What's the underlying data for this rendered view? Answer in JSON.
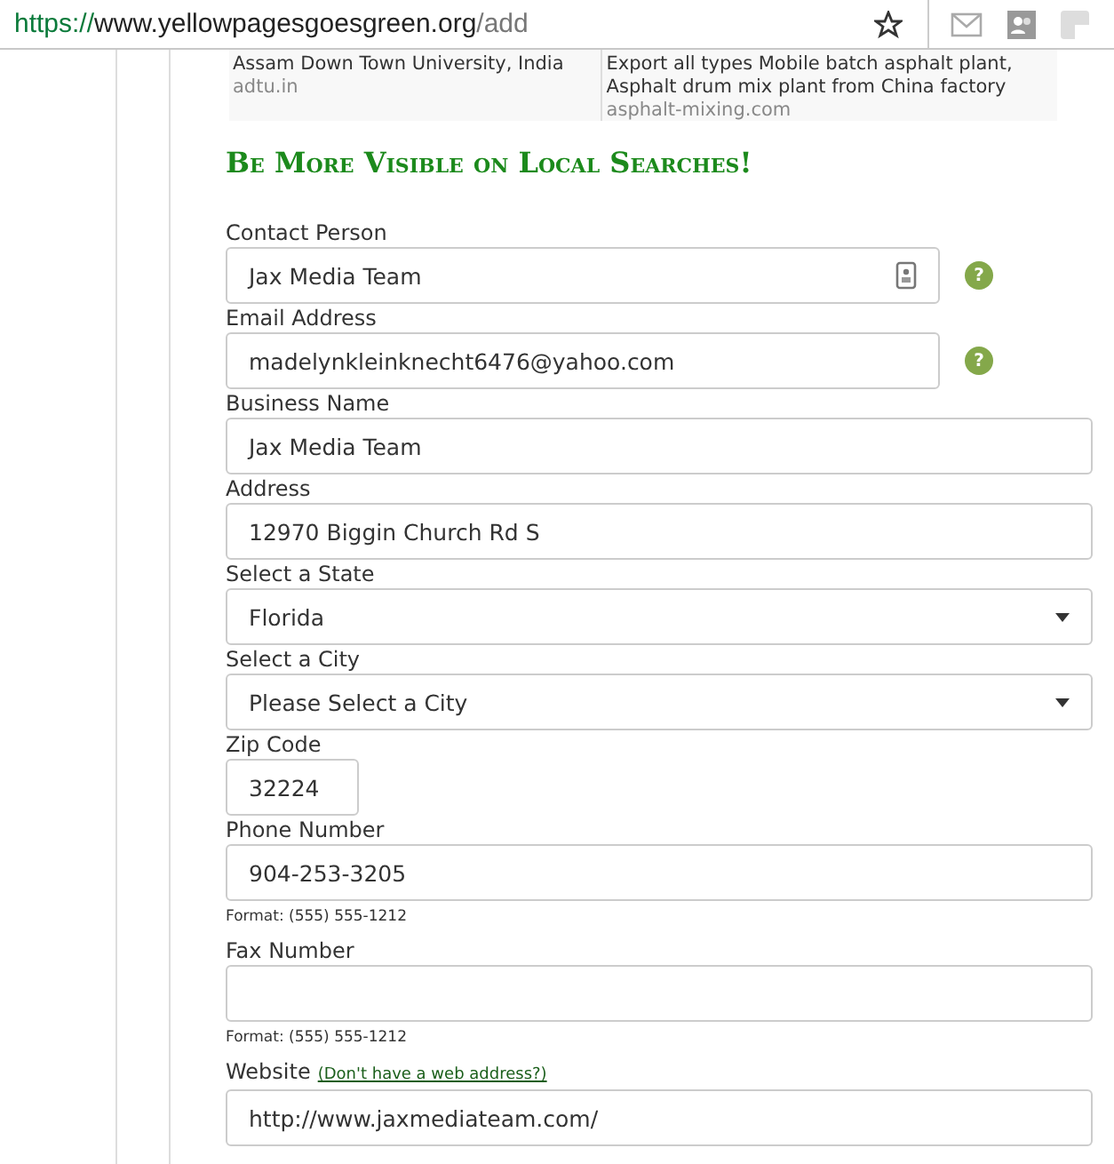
{
  "browser": {
    "url_scheme": "https://",
    "url_host": "www.yellowpagesgoesgreen.org",
    "url_path": "/add"
  },
  "ads": [
    {
      "description": "Assam Down Town University, India",
      "domain": "adtu.in"
    },
    {
      "description": "Export all types Mobile batch asphalt plant, Asphalt drum mix plant from China factory",
      "domain": "asphalt-mixing.com"
    }
  ],
  "heading": "Be More Visible on Local Searches!",
  "fields": [
    {
      "kind": "text",
      "label": "Contact Person",
      "value": "Jax Media Team",
      "help": "?",
      "autofill": true
    },
    {
      "kind": "text",
      "label": "Email Address",
      "value": "madelynkleinknecht6476@yahoo.com",
      "help": "?"
    },
    {
      "kind": "text",
      "label": "Business Name",
      "value": "Jax Media Team"
    },
    {
      "kind": "text",
      "label": "Address",
      "value": "12970 Biggin Church Rd S"
    },
    {
      "kind": "select",
      "label": "Select a State",
      "value": "Florida"
    },
    {
      "kind": "select",
      "label": "Select a City",
      "value": "Please Select a City"
    },
    {
      "kind": "short",
      "label": "Zip Code",
      "value": "32224"
    },
    {
      "kind": "text",
      "label": "Phone Number",
      "value": "904-253-3205",
      "hint": "Format: (555) 555-1212"
    },
    {
      "kind": "text",
      "label": "Fax Number",
      "hint": "Format: (555) 555-1212"
    },
    {
      "kind": "text",
      "label": "Website",
      "link": "(Don't have a web address?)",
      "value": "http://www.jaxmediateam.com/"
    }
  ]
}
